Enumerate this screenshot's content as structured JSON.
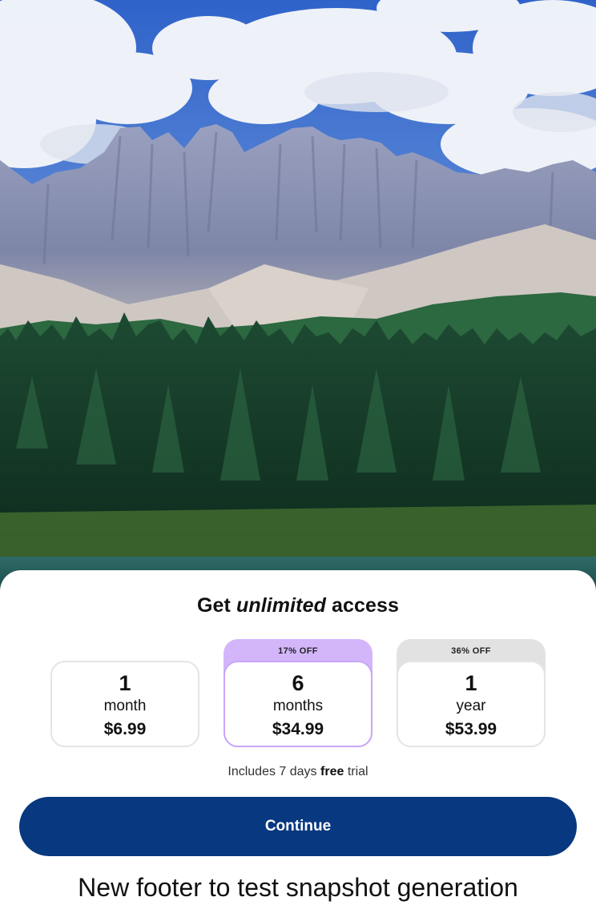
{
  "hero": {
    "image": "mountain-lake-forest-landscape"
  },
  "paywall": {
    "title_prefix": "Get",
    "title_emphasis": "unlimited",
    "title_suffix": "access",
    "plans": [
      {
        "badge": "",
        "quantity": "1",
        "unit": "month",
        "price": "$6.99",
        "selected": false
      },
      {
        "badge": "17% OFF",
        "quantity": "6",
        "unit": "months",
        "price": "$34.99",
        "selected": true
      },
      {
        "badge": "36% OFF",
        "quantity": "1",
        "unit": "year",
        "price": "$53.99",
        "selected": false
      }
    ],
    "trial_prefix": "Includes 7 days",
    "trial_bold": "free",
    "trial_suffix": "trial",
    "continue_label": "Continue",
    "footer_text": "New footer to test snapshot generation"
  },
  "colors": {
    "button": "#073880",
    "selected_badge": "#d3b6fa",
    "grey_badge": "#e2e2e2"
  }
}
